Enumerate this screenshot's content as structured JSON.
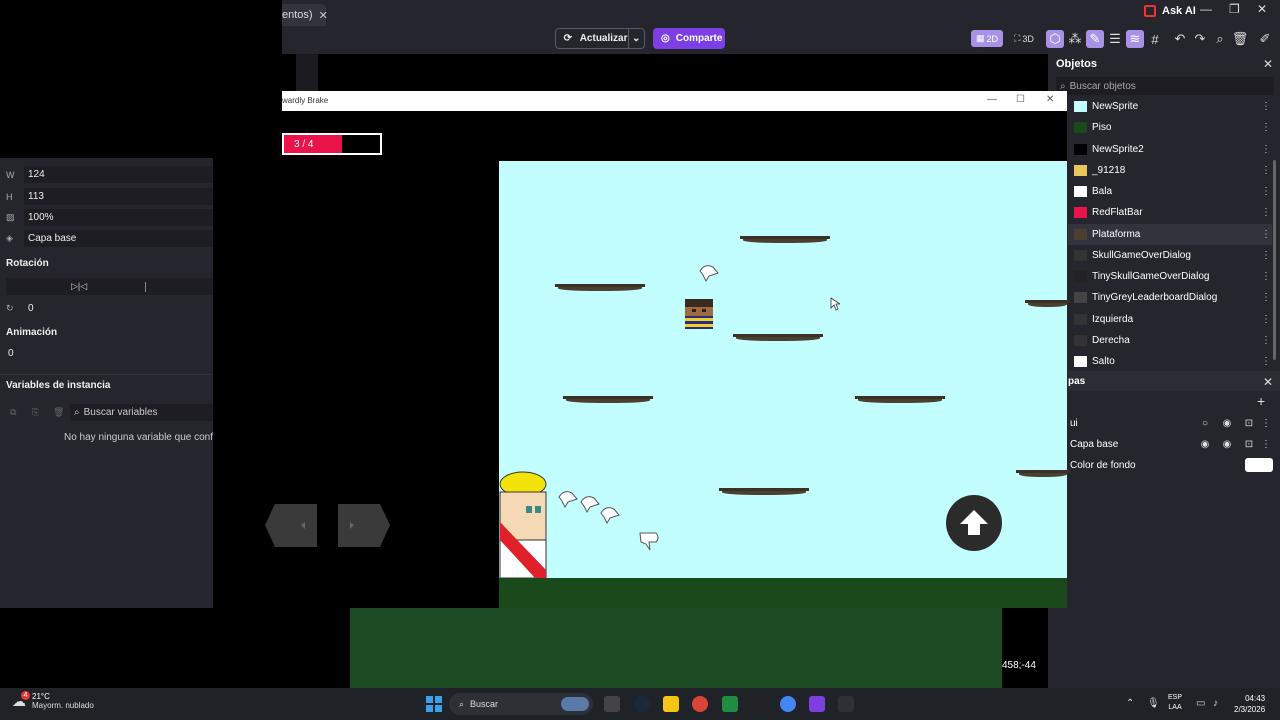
{
  "app": {
    "tab_label": "entos)",
    "ask_ai": "Ask AI",
    "toolbar": {
      "refresh_label": "Actualizar",
      "share_label": "Comparte",
      "view_2d": "2D",
      "view_3d": "3D"
    }
  },
  "properties": {
    "w_label": "W",
    "w_value": "124",
    "h_label": "H",
    "h_value": "113",
    "opacity_value": "100%",
    "layer_value": "Capa base",
    "rotation_title": "Rotación",
    "rotation_value": "0",
    "animation_title": "Animación",
    "animation_value": "0",
    "instance_vars_title": "Variables de instancia",
    "search_vars_placeholder": "Buscar variables",
    "no_vars_text": "No hay ninguna variable que config"
  },
  "objects_panel": {
    "title": "Objetos",
    "search_placeholder": "Buscar objetos",
    "items": [
      {
        "name": "NewSprite",
        "color": "#c2fefe"
      },
      {
        "name": "Piso",
        "color": "#1a4a1c"
      },
      {
        "name": "NewSprite2",
        "color": "#000000"
      },
      {
        "name": "_91218",
        "color": "#e8c65a"
      },
      {
        "name": "Bala",
        "color": "#ffffff"
      },
      {
        "name": "RedFlatBar",
        "color": "#e8144a"
      },
      {
        "name": "Plataforma",
        "color": "#4a3f30"
      },
      {
        "name": "SkullGameOverDialog",
        "color": "#333333"
      },
      {
        "name": "TinySkullGameOverDialog",
        "color": "#222222"
      },
      {
        "name": "TinyGreyLeaderboardDialog",
        "color": "#444444"
      },
      {
        "name": "Izquierda",
        "color": "#333333"
      },
      {
        "name": "Derecha",
        "color": "#333333"
      },
      {
        "name": "Salto",
        "color": "#ffffff"
      }
    ],
    "selected_index": 6
  },
  "layers_panel": {
    "title": "pas",
    "layers": [
      {
        "name": "ui"
      },
      {
        "name": "Capa base"
      }
    ],
    "bg_color_label": "Color de fondo",
    "bg_color": "#ffffff"
  },
  "game_window": {
    "title": "wardly Brake",
    "health_text": "3 / 4",
    "health_fraction": 0.75
  },
  "scene": {
    "coords": "458;-44"
  },
  "taskbar": {
    "weather_temp": "21°C",
    "weather_desc": "Mayorm. nublado",
    "weather_badge": "4",
    "search_placeholder": "Buscar",
    "lang_line1": "ESP",
    "lang_line2": "LAA",
    "time": "04:43",
    "date": "2/3/2026"
  }
}
